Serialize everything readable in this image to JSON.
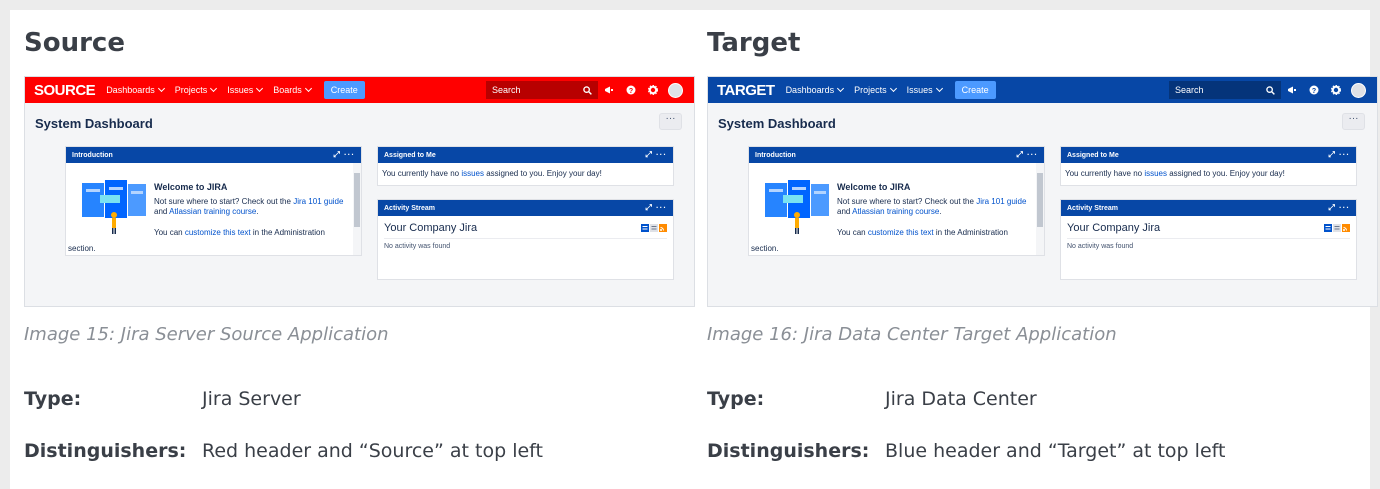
{
  "panels": [
    {
      "heading": "Source",
      "jira": {
        "logo": "SOURCE",
        "header_color": "#ff0000",
        "search_bg": "#b80000",
        "nav": [
          "Dashboards",
          "Projects",
          "Issues",
          "Boards"
        ],
        "create_label": "Create",
        "search_placeholder": "Search",
        "dashboard_title": "System Dashboard",
        "more_label": "···",
        "intro": {
          "title": "Introduction",
          "welcome": "Welcome to JIRA",
          "line1a": "Not sure where to start? Check out the ",
          "link1": "Jira 101 guide",
          "line1b": " and ",
          "link2": "Atlassian training course",
          "line1c": ".",
          "line2a": "You can ",
          "link3": "customize this text",
          "line2b": " in the Administration",
          "line3": "section."
        },
        "assigned": {
          "title": "Assigned to Me",
          "text_a": "You currently have no ",
          "link": "issues",
          "text_b": " assigned to you. Enjoy your day!"
        },
        "activity": {
          "title": "Activity Stream",
          "company": "Your Company Jira",
          "empty": "No activity was found"
        }
      },
      "caption": "Image 15: Jira Server Source Application",
      "type_label": "Type:",
      "type_value": "Jira Server",
      "dist_label": "Distinguishers:",
      "dist_value": "Red header and “Source” at top left"
    },
    {
      "heading": "Target",
      "jira": {
        "logo": "TARGET",
        "header_color": "#0747a6",
        "search_bg": "#05347a",
        "nav": [
          "Dashboards",
          "Projects",
          "Issues"
        ],
        "create_label": "Create",
        "search_placeholder": "Search",
        "dashboard_title": "System Dashboard",
        "more_label": "···",
        "intro": {
          "title": "Introduction",
          "welcome": "Welcome to JIRA",
          "line1a": "Not sure where to start? Check out the ",
          "link1": "Jira 101 guide",
          "line1b": " and ",
          "link2": "Atlassian training course",
          "line1c": ".",
          "line2a": "You can ",
          "link3": "customize this text",
          "line2b": " in the Administration",
          "line3": "section."
        },
        "assigned": {
          "title": "Assigned to Me",
          "text_a": "You currently have no ",
          "link": "issues",
          "text_b": " assigned to you. Enjoy your day!"
        },
        "activity": {
          "title": "Activity Stream",
          "company": "Your Company Jira",
          "empty": "No activity was found"
        }
      },
      "caption": "Image 16: Jira Data Center Target Application",
      "type_label": "Type:",
      "type_value": "Jira Data Center",
      "dist_label": "Distinguishers:",
      "dist_value": "Blue header and “Target” at top left"
    }
  ],
  "icons": {
    "search": "search-icon",
    "notifications": "megaphone-icon",
    "help": "help-icon",
    "settings": "gear-icon",
    "avatar": "avatar"
  }
}
